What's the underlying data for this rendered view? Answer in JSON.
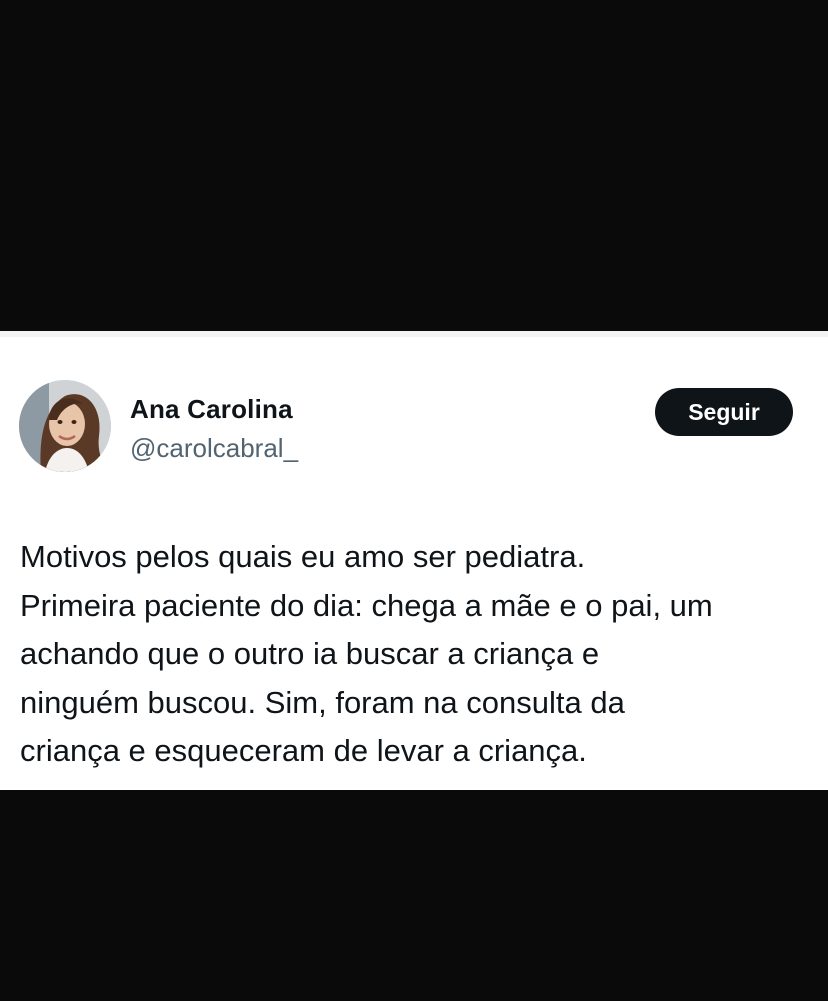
{
  "tweet": {
    "author": {
      "display_name": "Ana Carolina",
      "handle": "@carolcabral_",
      "avatar_icon": "profile-photo"
    },
    "follow_button_label": "Seguir",
    "text_lines": [
      "Motivos pelos quais eu amo ser pediatra.",
      "Primeira paciente do dia: chega a mãe e o pai, um",
      "achando que o outro ia buscar a criança e",
      "ninguém buscou. Sim, foram na consulta da",
      "criança e esqueceram de levar a criança."
    ]
  },
  "colors": {
    "background": "#0a0a0a",
    "card": "#ffffff",
    "text_primary": "#0f1419",
    "text_secondary": "#536471",
    "button": "#0f1419"
  }
}
